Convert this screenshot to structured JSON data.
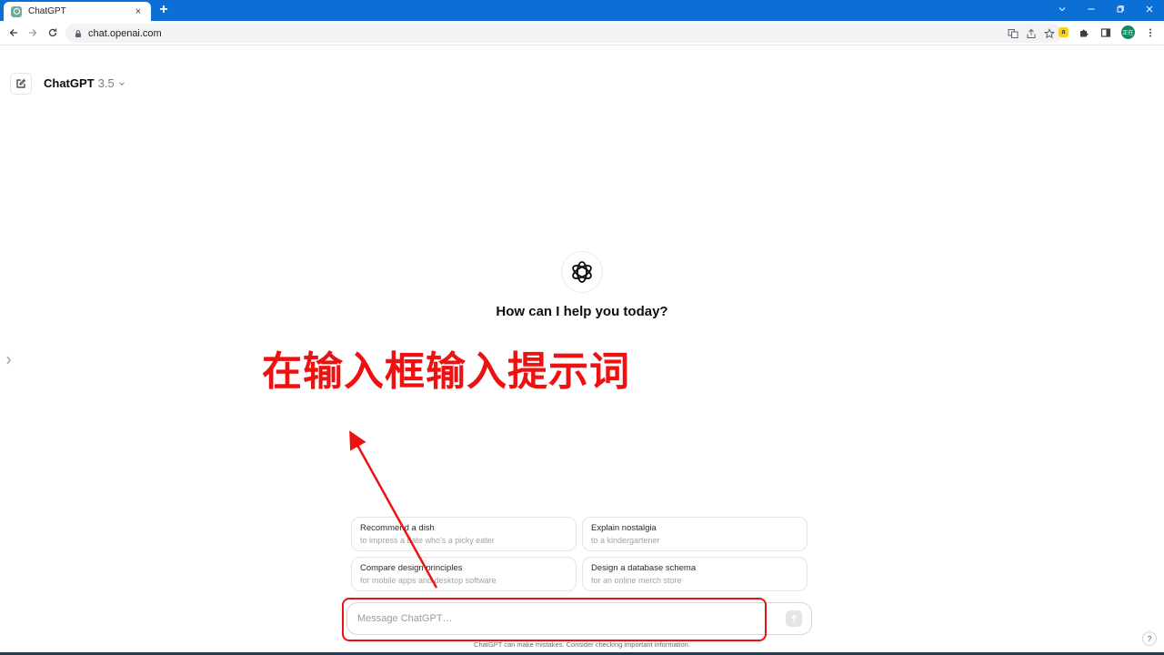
{
  "browser": {
    "tab_title": "ChatGPT",
    "tab_close": "×",
    "new_tab": "+",
    "url": "chat.openai.com",
    "profile_initials": "正在",
    "extension_label": "a"
  },
  "header": {
    "model_name": "ChatGPT",
    "model_version": "3.5"
  },
  "main": {
    "greeting": "How can I help you today?"
  },
  "annotation": {
    "text": "在输入框输入提示词",
    "color": "#ee1111"
  },
  "suggestions": [
    {
      "title": "Recommend a dish",
      "subtitle": "to impress a date who's a picky eater"
    },
    {
      "title": "Explain nostalgia",
      "subtitle": "to a kindergartener"
    },
    {
      "title": "Compare design principles",
      "subtitle": "for mobile apps and desktop software"
    },
    {
      "title": "Design a database schema",
      "subtitle": "for an online merch store"
    }
  ],
  "composer": {
    "placeholder": "Message ChatGPT…",
    "value": ""
  },
  "footer": {
    "disclaimer": "ChatGPT can make mistakes. Consider checking important information.",
    "help": "?"
  },
  "colors": {
    "tabstrip": "#0b6fd6",
    "accent_red": "#ee1111"
  }
}
